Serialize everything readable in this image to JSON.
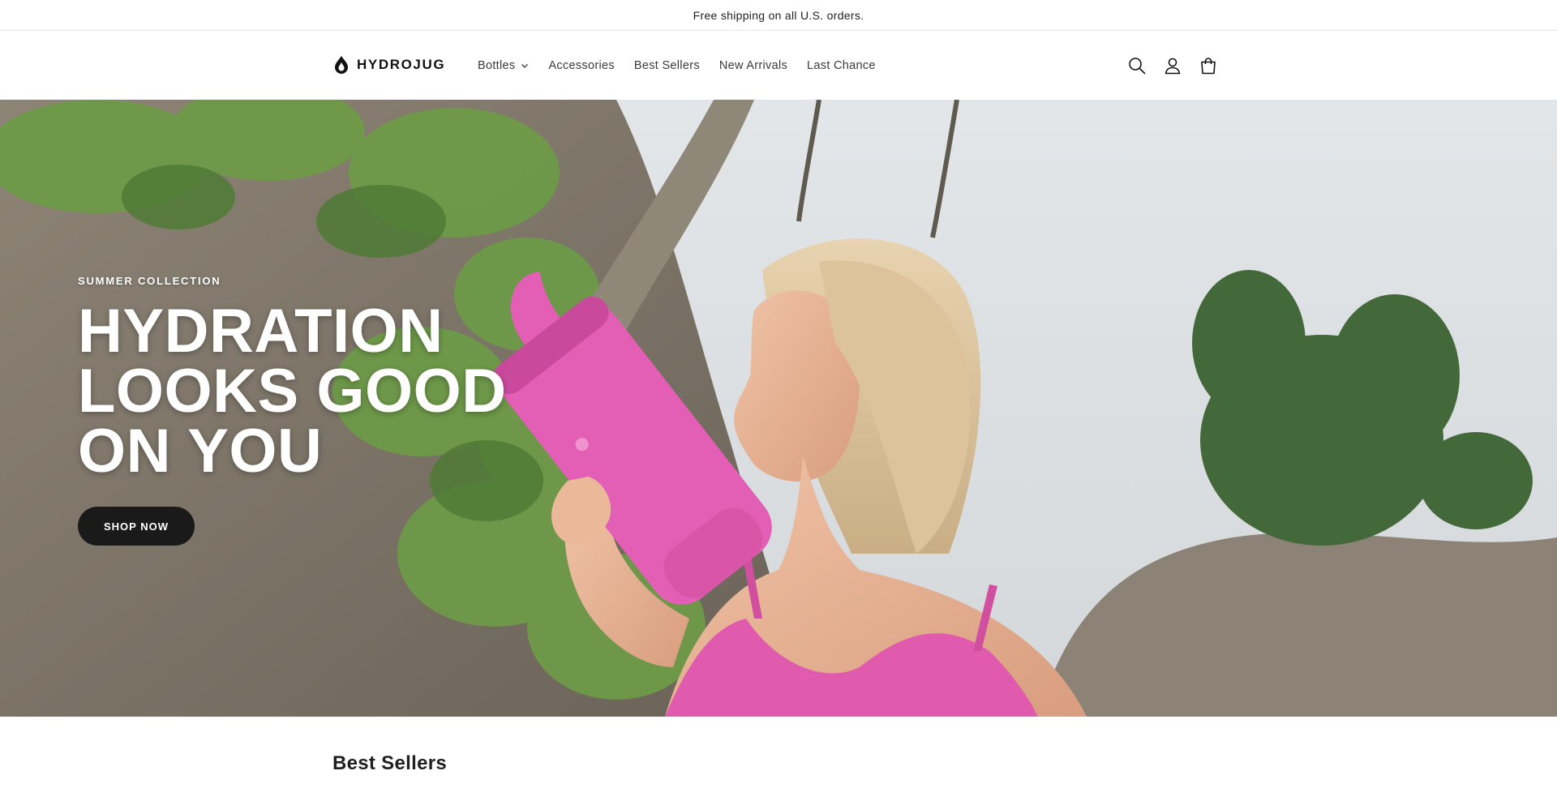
{
  "announcement": {
    "text": "Free shipping on all U.S. orders."
  },
  "header": {
    "logo_text": "HYDROJUG",
    "nav": [
      {
        "label": "Bottles",
        "has_dropdown": true
      },
      {
        "label": "Accessories"
      },
      {
        "label": "Best Sellers"
      },
      {
        "label": "New Arrivals"
      },
      {
        "label": "Last Chance"
      }
    ],
    "icons": [
      "search-icon",
      "account-icon",
      "cart-icon"
    ]
  },
  "hero": {
    "eyebrow": "SUMMER COLLECTION",
    "title_lines": [
      "HYDRATION",
      "LOOKS GOOD",
      "ON YOU"
    ],
    "cta_label": "SHOP NOW"
  },
  "best_sellers": {
    "title": "Best Sellers"
  },
  "colors": {
    "accent_pink": "#e05aae",
    "button_dark": "#1a1a1a",
    "foliage_green": "#6e9a48"
  }
}
